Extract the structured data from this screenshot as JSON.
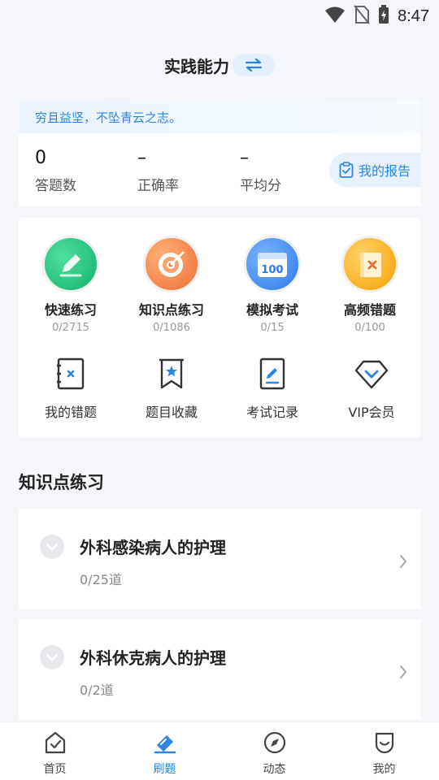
{
  "status_bar": {
    "time": "8:47",
    "icons": [
      "wifi-icon",
      "no-sim-icon",
      "battery-charging-icon"
    ]
  },
  "header": {
    "title": "实践能力",
    "switch_icon": "swap-arrows-icon"
  },
  "stats": {
    "motto": "穷且益坚，不坠青云之志。",
    "items": [
      {
        "value": "0",
        "label": "答题数"
      },
      {
        "value": "–",
        "label": "正确率"
      },
      {
        "value": "–",
        "label": "平均分"
      }
    ],
    "report_label": "我的报告",
    "report_icon": "clipboard-check-icon"
  },
  "practice_modes": [
    {
      "name": "快速练习",
      "count": "0/2715",
      "icon": "pencil-icon",
      "color": "#1fbf7a"
    },
    {
      "name": "知识点练习",
      "count": "0/1086",
      "icon": "target-icon",
      "color": "#f08a4b"
    },
    {
      "name": "模拟考试",
      "count": "0/15",
      "icon": "calendar-100-icon",
      "color": "#3f8cf0"
    },
    {
      "name": "高频错题",
      "count": "0/100",
      "icon": "wrong-book-icon",
      "color": "#f5a623"
    }
  ],
  "tools": [
    {
      "name": "我的错题",
      "icon": "wrong-note-icon"
    },
    {
      "name": "题目收藏",
      "icon": "bookmark-star-icon"
    },
    {
      "name": "考试记录",
      "icon": "exam-record-icon"
    },
    {
      "name": "VIP会员",
      "icon": "diamond-icon"
    }
  ],
  "section_title": "知识点练习",
  "topics": [
    {
      "title": "外科感染病人的护理",
      "count": "0/25道"
    },
    {
      "title": "外科休克病人的护理",
      "count": "0/2道"
    }
  ],
  "bottom_nav": [
    {
      "label": "首页",
      "icon": "home-check-icon",
      "active": false
    },
    {
      "label": "刷题",
      "icon": "eraser-brush-icon",
      "active": true
    },
    {
      "label": "动态",
      "icon": "compass-icon",
      "active": false
    },
    {
      "label": "我的",
      "icon": "profile-smile-icon",
      "active": false
    }
  ],
  "colors": {
    "accent": "#2a86e0",
    "background": "#f4f6fa",
    "card": "#ffffff"
  }
}
